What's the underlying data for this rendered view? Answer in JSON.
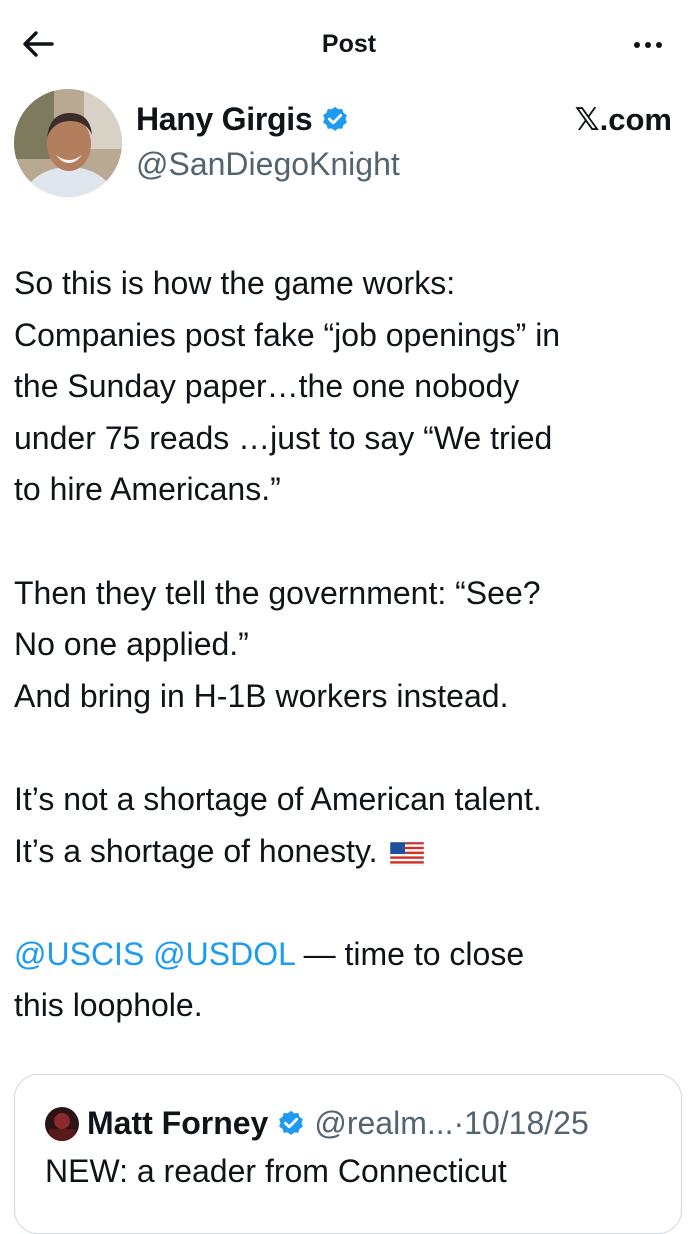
{
  "header": {
    "title": "Post",
    "back_icon": "arrow-left-icon",
    "more_icon": "more-horizontal-icon"
  },
  "author": {
    "name": "Hany Girgis",
    "handle": "@SanDiegoKnight",
    "verified_icon": "verified-badge-icon",
    "badge_color": "#1d9bf0"
  },
  "source_label": "𝕏.com",
  "post": {
    "lines": [
      "So this is how the game works:",
      "Companies post fake “job openings” in",
      "the Sunday paper…the one nobody",
      "under 75 reads …just to say “We tried",
      "to hire Americans.”",
      "Then they tell the government: “See?",
      "No one applied.”",
      "And bring in H-1B workers instead.",
      "It’s not a shortage of American talent.",
      "It’s a shortage of honesty."
    ],
    "flag_icon": "us-flag-icon",
    "mentions": [
      "@USCIS",
      "@USDOL"
    ],
    "mention_tail": " — time to close",
    "final_line": "this loophole.",
    "mention_color": "#1d9bf0"
  },
  "quote": {
    "name": "Matt Forney",
    "handle": "@realm...",
    "separator": "·",
    "date": "10/18/25",
    "text": "NEW: a reader from Connecticut"
  },
  "colors": {
    "text": "#0f1419",
    "secondary": "#536471",
    "border": "#cfd9de"
  }
}
